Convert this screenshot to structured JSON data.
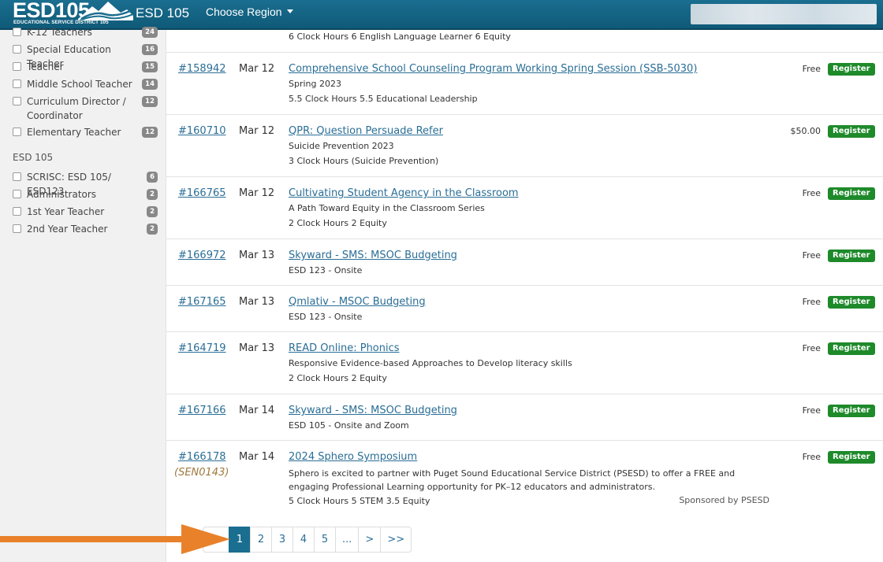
{
  "header": {
    "logo_text": "ESD105",
    "logo_subtext": "EDUCATIONAL SERVICE DISTRICT 105",
    "site_name": "ESD 105",
    "region_label": "Choose Region"
  },
  "sidebar": {
    "filters": [
      {
        "label": "K-12 Teachers",
        "count": "24"
      },
      {
        "label": "Special Education Teacher",
        "count": "16"
      },
      {
        "label": "Teacher",
        "count": "15"
      },
      {
        "label": "Middle School Teacher",
        "count": "14"
      },
      {
        "label": "Curriculum Director / Coordinator",
        "count": "12"
      },
      {
        "label": "Elementary Teacher",
        "count": "12"
      }
    ],
    "group_heading": "ESD 105",
    "group_filters": [
      {
        "label": "SCRISC: ESD 105/ ESD123",
        "count": "6"
      },
      {
        "label": "Administrators",
        "count": "2"
      },
      {
        "label": "1st Year Teacher",
        "count": "2"
      },
      {
        "label": "2nd Year Teacher",
        "count": "2"
      }
    ]
  },
  "events": {
    "top_partial_hours": "6 Clock Hours   6 English Language Learner   6 Equity",
    "register_label": "Register",
    "rows": [
      {
        "id": "#158942",
        "date": "Mar 12",
        "title": "Comprehensive School Counseling Program Working Spring Session (SSB-5030)",
        "line1": "Spring 2023",
        "line2": "5.5 Clock Hours   5.5 Educational Leadership",
        "price": "Free"
      },
      {
        "id": "#160710",
        "date": "Mar 12",
        "title": "QPR: Question Persuade Refer",
        "line1": "Suicide Prevention 2023",
        "line2": "3 Clock Hours (Suicide Prevention)",
        "price": "$50.00"
      },
      {
        "id": "#166765",
        "date": "Mar 12",
        "title": "Cultivating Student Agency in the Classroom",
        "line1": "A Path Toward Equity in the Classroom Series",
        "line2": "2 Clock Hours   2 Equity",
        "price": "Free"
      },
      {
        "id": "#166972",
        "date": "Mar 13",
        "title": "Skyward - SMS: MSOC Budgeting",
        "line1": "ESD 123 - Onsite",
        "price": "Free"
      },
      {
        "id": "#167165",
        "date": "Mar 13",
        "title": "Qmlativ - MSOC Budgeting",
        "line1": "ESD 123 - Onsite",
        "price": "Free"
      },
      {
        "id": "#164719",
        "date": "Mar 13",
        "title": "READ Online: Phonics",
        "line1": "Responsive Evidence-based Approaches to Develop literacy skills",
        "line2": "2 Clock Hours   2 Equity",
        "price": "Free"
      },
      {
        "id": "#167166",
        "date": "Mar 14",
        "title": "Skyward - SMS: MSOC Budgeting",
        "line1": "ESD 105 - Onsite and Zoom",
        "price": "Free"
      },
      {
        "id": "#166178",
        "code": "(SEN0143)",
        "date": "Mar 14",
        "title": "2024 Sphero Symposium",
        "description": "Sphero is excited to partner with Puget Sound Educational Service District (PSESD) to offer a FREE and engaging Professional Learning opportunity for PK–12 educators and administrators.",
        "line2": "5 Clock Hours   5 STEM   3.5 Equity",
        "sponsor": "Sponsored by PSESD",
        "price": "Free"
      }
    ]
  },
  "pagination": {
    "prev": "<",
    "pages": [
      "1",
      "2",
      "3",
      "4",
      "5"
    ],
    "ellipsis": "...",
    "next": ">",
    "last": ">>",
    "active_page": "1"
  },
  "colors": {
    "header_bg": "#1a6e8f",
    "link": "#2a6e96",
    "register_bg": "#1e8a2a",
    "annotation_arrow": "#e8812a"
  }
}
